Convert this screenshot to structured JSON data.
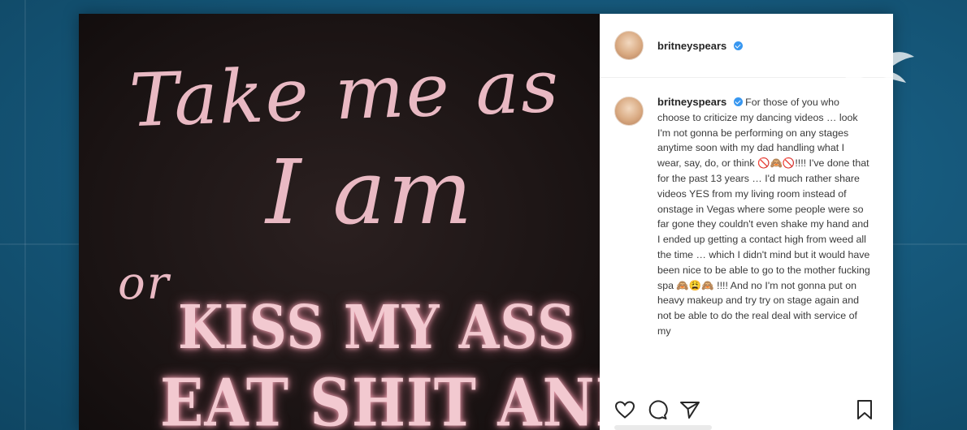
{
  "image_text": {
    "line1": "Take me as",
    "line2": "I am",
    "line3": "or",
    "line4": "KISS MY ASS",
    "line5": "EAT SHIT AND"
  },
  "post": {
    "username": "britneyspears",
    "caption": "For those of you who choose to criticize my dancing videos … look I'm not gonna be performing on any stages anytime soon with my dad handling what I wear, say, do, or think 🚫🙈🚫!!!! I've done that for the past 13 years … I'd much rather share videos YES from my living room instead of onstage in Vegas where some people were so far gone they couldn't even shake my hand and I ended up getting a contact high from weed all the time … which I didn't mind but it would have been nice to be able to go to the mother fucking spa 🙈😩🙈 !!!! And no I'm not gonna put on heavy makeup and try try on stage again and not be able to do the real deal with service of my"
  },
  "icons": [
    "heart-icon",
    "comment-icon",
    "share-icon",
    "bookmark-icon",
    "verified-icon"
  ]
}
